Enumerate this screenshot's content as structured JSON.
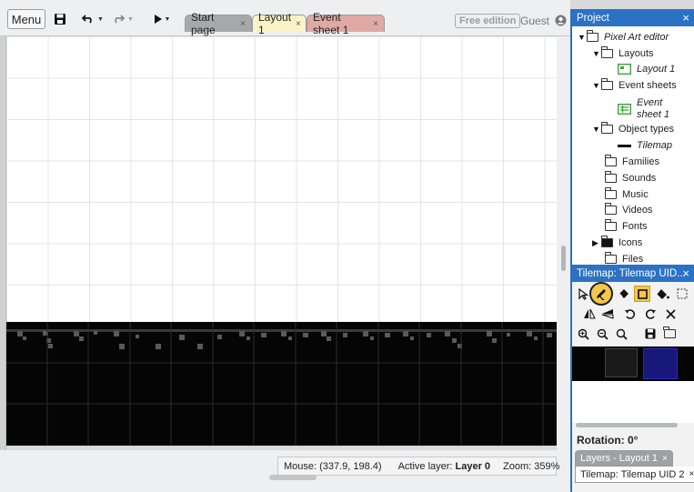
{
  "toolbar": {
    "menu_label": "Menu",
    "icons": [
      "save-icon",
      "undo-icon",
      "redo-icon",
      "play-icon"
    ],
    "tabs": [
      {
        "label": "Start page",
        "close": "×"
      },
      {
        "label": "Layout 1",
        "close": "×"
      },
      {
        "label": "Event sheet 1",
        "close": "×"
      }
    ],
    "free_edition": "Free edition",
    "guest": "Guest"
  },
  "status": {
    "mouse_label": "Mouse:",
    "mouse_value": "(337.9, 198.4)",
    "active_layer_label": "Active layer:",
    "active_layer_value": "Layer 0",
    "zoom_label": "Zoom:",
    "zoom_value": "359%"
  },
  "project": {
    "title": "Project",
    "close": "×",
    "root": "Pixel Art editor",
    "layouts": "Layouts",
    "layout1": "Layout 1",
    "event_sheets": "Event sheets",
    "event_sheet1_a": "Event",
    "event_sheet1_b": "sheet 1",
    "object_types": "Object types",
    "tilemap": "Tilemap",
    "families": "Families",
    "sounds": "Sounds",
    "music": "Music",
    "videos": "Videos",
    "fonts": "Fonts",
    "icons": "Icons",
    "files": "Files"
  },
  "tilemap_panel": {
    "title": "Tilemap: Tilemap UID...",
    "close": "×",
    "rotation_label": "Rotation:",
    "rotation_value": "0°",
    "layers_tab": "Layers - Layout 1",
    "tilemap_tab": "Tilemap: Tilemap UID 2",
    "tab_close": "×"
  },
  "colors": {
    "accent": "#2c72c4",
    "highlight": "#f4c64a",
    "layout_tab": "#fbf3c7",
    "event_tab": "#dfa9a4"
  }
}
